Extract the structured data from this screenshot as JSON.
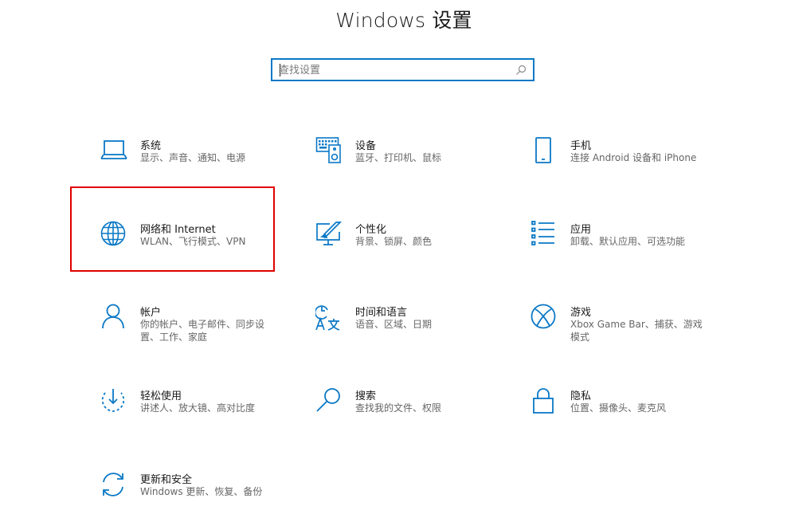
{
  "window": {
    "title": "Windows 设置"
  },
  "search": {
    "placeholder": "查找设置"
  },
  "accent_color": "#0a78c6",
  "highlight_color": "#e00000",
  "tiles": [
    {
      "name": "系统",
      "desc": "显示、声音、通知、电源",
      "icon": "laptop-icon"
    },
    {
      "name": "设备",
      "desc": "蓝牙、打印机、鼠标",
      "icon": "keyboard-speaker-icon"
    },
    {
      "name": "手机",
      "desc": "连接 Android 设备和 iPhone",
      "icon": "phone-icon"
    },
    {
      "name": "网络和 Internet",
      "desc": "WLAN、飞行模式、VPN",
      "icon": "globe-icon",
      "highlighted": true
    },
    {
      "name": "个性化",
      "desc": "背景、锁屏、颜色",
      "icon": "pen-monitor-icon"
    },
    {
      "name": "应用",
      "desc": "卸载、默认应用、可选功能",
      "icon": "app-list-icon"
    },
    {
      "name": "帐户",
      "desc": "你的帐户、电子邮件、同步设置、工作、家庭",
      "icon": "person-icon"
    },
    {
      "name": "时间和语言",
      "desc": "语音、区域、日期",
      "icon": "time-language-icon"
    },
    {
      "name": "游戏",
      "desc": "Xbox Game Bar、捕获、游戏模式",
      "icon": "xbox-icon"
    },
    {
      "name": "轻松使用",
      "desc": "讲述人、放大镜、高对比度",
      "icon": "ease-of-access-icon"
    },
    {
      "name": "搜索",
      "desc": "查找我的文件、权限",
      "icon": "search-icon"
    },
    {
      "name": "隐私",
      "desc": "位置、摄像头、麦克风",
      "icon": "lock-icon"
    },
    {
      "name": "更新和安全",
      "desc": "Windows 更新、恢复、备份",
      "icon": "sync-icon"
    }
  ]
}
